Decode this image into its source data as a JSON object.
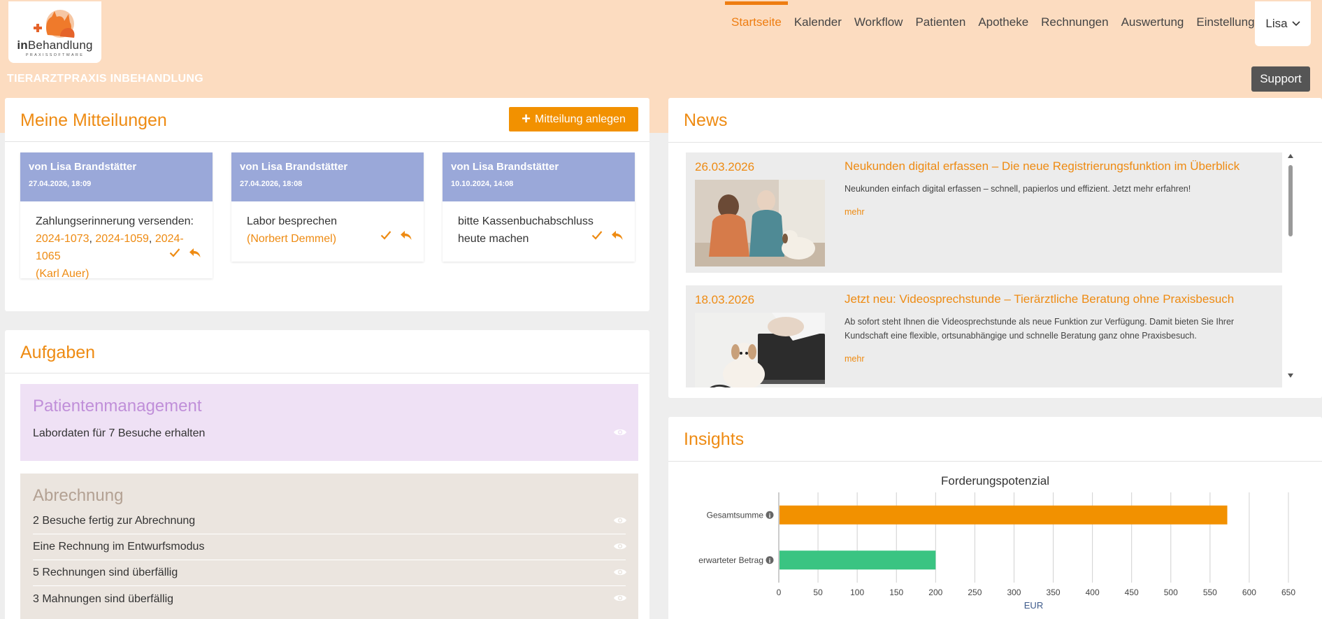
{
  "brand": {
    "logo_bold": "in",
    "logo_rest": "Behandlung",
    "logo_sub": "PRAXISSOFTWARE"
  },
  "nav": {
    "items": [
      {
        "label": "Startseite",
        "active": true
      },
      {
        "label": "Kalender"
      },
      {
        "label": "Workflow"
      },
      {
        "label": "Patienten"
      },
      {
        "label": "Apotheke"
      },
      {
        "label": "Rechnungen"
      },
      {
        "label": "Auswertung"
      },
      {
        "label": "Einstellungen"
      }
    ],
    "user": "Lisa"
  },
  "header": {
    "practice_name": "TIERARZTPRAXIS INBEHANDLUNG",
    "support_label": "Support"
  },
  "messages": {
    "title": "Meine Mitteilungen",
    "add_label": "Mitteilung anlegen",
    "cards": [
      {
        "from": "von Lisa Brandstätter",
        "date": "27.04.2026, 18:09",
        "text": "Zahlungserinnerung versenden:",
        "refs": [
          "2024-1073",
          "2024-1059",
          "2024-1065"
        ],
        "sep": ", ",
        "person": "(Karl Auer)"
      },
      {
        "from": "von Lisa Brandstätter",
        "date": "27.04.2026, 18:08",
        "text": "Labor besprechen",
        "person": "(Norbert Demmel)"
      },
      {
        "from": "von Lisa Brandstätter",
        "date": "10.10.2024, 14:08",
        "text_line1": "bitte Kassenbuchabschluss",
        "text_line2": "heute machen"
      }
    ]
  },
  "tasks": {
    "title": "Aufgaben",
    "groups": [
      {
        "title": "Patientenmanagement",
        "bg": "#efe1f5",
        "title_color": "#c08fd9",
        "items": [
          "Labordaten für 7 Besuche erhalten"
        ]
      },
      {
        "title": "Abrechnung",
        "bg": "#ebe5df",
        "title_color": "#b3a193",
        "items": [
          "2 Besuche fertig zur Abrechnung",
          "Eine Rechnung im Entwurfsmodus",
          "5 Rechnungen sind überfällig",
          "3 Mahnungen sind überfällig"
        ]
      }
    ]
  },
  "news": {
    "title": "News",
    "items": [
      {
        "date": "26.03.2026",
        "headline": "Neukunden digital erfassen – Die neue Registrierungsfunktion im Überblick",
        "text": "Neukunden einfach digital erfassen – schnell, papierlos und effizient. Jetzt mehr erfahren!",
        "more": "mehr",
        "image": "vet-consultation-photo"
      },
      {
        "date": "18.03.2026",
        "headline": "Jetzt neu: Videosprechstunde – Tierärztliche Beratung ohne Praxisbesuch",
        "text": "Ab sofort steht Ihnen die Videosprechstunde als neue Funktion zur Verfügung. Damit bieten Sie Ihrer Kundschaft eine flexible, ortsunabhängige und schnelle Beratung ganz ohne Praxisbesuch.",
        "more": "mehr",
        "image": "puppy-laptop-photo"
      }
    ]
  },
  "insights": {
    "title": "Insights"
  },
  "chart_data": {
    "type": "bar",
    "orientation": "horizontal",
    "title": "Forderungspotenzial",
    "categories": [
      "Gesamtsumme",
      "erwarteter Betrag"
    ],
    "values": [
      572,
      200
    ],
    "colors": [
      "#f29100",
      "#3ac482"
    ],
    "xlabel": "EUR",
    "xlim": [
      0,
      650
    ],
    "xticks": [
      "0",
      "50",
      "100",
      "150",
      "200",
      "250",
      "300",
      "350",
      "400",
      "450",
      "500",
      "550",
      "600",
      "650"
    ],
    "grid": true
  },
  "colors": {
    "accent": "#ee8b13",
    "header_bg": "#fcdcc0",
    "message_header": "#9aa8d9"
  }
}
